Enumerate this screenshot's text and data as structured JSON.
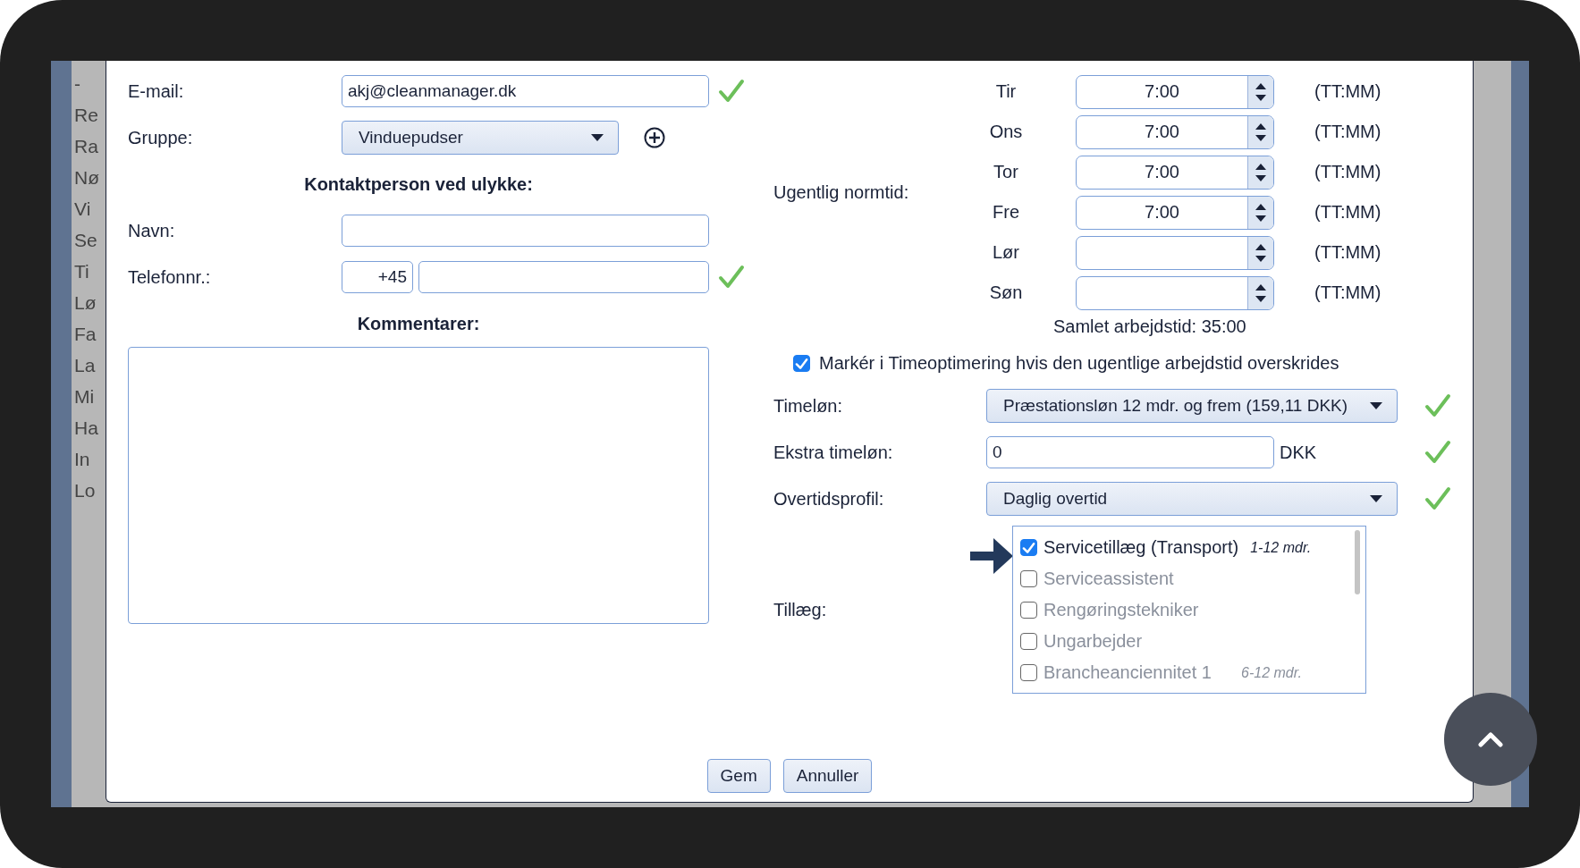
{
  "sidebar": {
    "items": [
      "-",
      "Re",
      "Ra",
      "Nø",
      "Vi",
      "Se",
      "Ti",
      "Lø",
      "Fa",
      "La",
      "Mi",
      "Ha",
      "In",
      "Lo"
    ]
  },
  "dialog": {
    "left": {
      "email": {
        "label": "E-mail:",
        "value": "akj@cleanmanager.dk",
        "valid": true
      },
      "group": {
        "label": "Gruppe:",
        "value": "Vinduepudser"
      },
      "contact_heading": "Kontaktperson ved ulykke:",
      "name": {
        "label": "Navn:"
      },
      "phone": {
        "label": "Telefonnr.:",
        "prefix": "+45",
        "valid": true
      },
      "comments": {
        "heading": "Kommentarer:"
      }
    },
    "weekly": {
      "label": "Ugentlig normtid:",
      "days": [
        {
          "day": "Tir",
          "value": "7:00",
          "unit": "(TT:MM)"
        },
        {
          "day": "Ons",
          "value": "7:00",
          "unit": "(TT:MM)"
        },
        {
          "day": "Tor",
          "value": "7:00",
          "unit": "(TT:MM)"
        },
        {
          "day": "Fre",
          "value": "7:00",
          "unit": "(TT:MM)"
        },
        {
          "day": "Lør",
          "unit": "(TT:MM)"
        },
        {
          "day": "Søn",
          "unit": "(TT:MM)"
        }
      ],
      "total": "Samlet arbejdstid: 35:00"
    },
    "flag": {
      "label": "Markér i Timeoptimering hvis den ugentlige arbejdstid overskrides",
      "checked": true
    },
    "hourly": {
      "label": "Timeløn:",
      "value": "Præstationsløn 12 mdr. og frem (159,11 DKK)",
      "valid": true
    },
    "extra": {
      "label": "Ekstra timeløn:",
      "value": "0",
      "unit": "DKK",
      "valid": true
    },
    "overtime": {
      "label": "Overtidsprofil:",
      "value": "Daglig overtid",
      "valid": true
    },
    "supplements": {
      "label": "Tillæg:",
      "items": [
        {
          "label": "Servicetillæg (Transport)",
          "note": "1-12 mdr.",
          "checked": true
        },
        {
          "label": "Serviceassistent",
          "checked": false
        },
        {
          "label": "Rengøringstekniker",
          "checked": false
        },
        {
          "label": "Ungarbejder",
          "checked": false
        },
        {
          "label": "Brancheanciennitet 1",
          "note": "6-12 mdr.",
          "checked": false
        }
      ]
    },
    "buttons": [
      "Gem",
      "Annuller"
    ]
  }
}
